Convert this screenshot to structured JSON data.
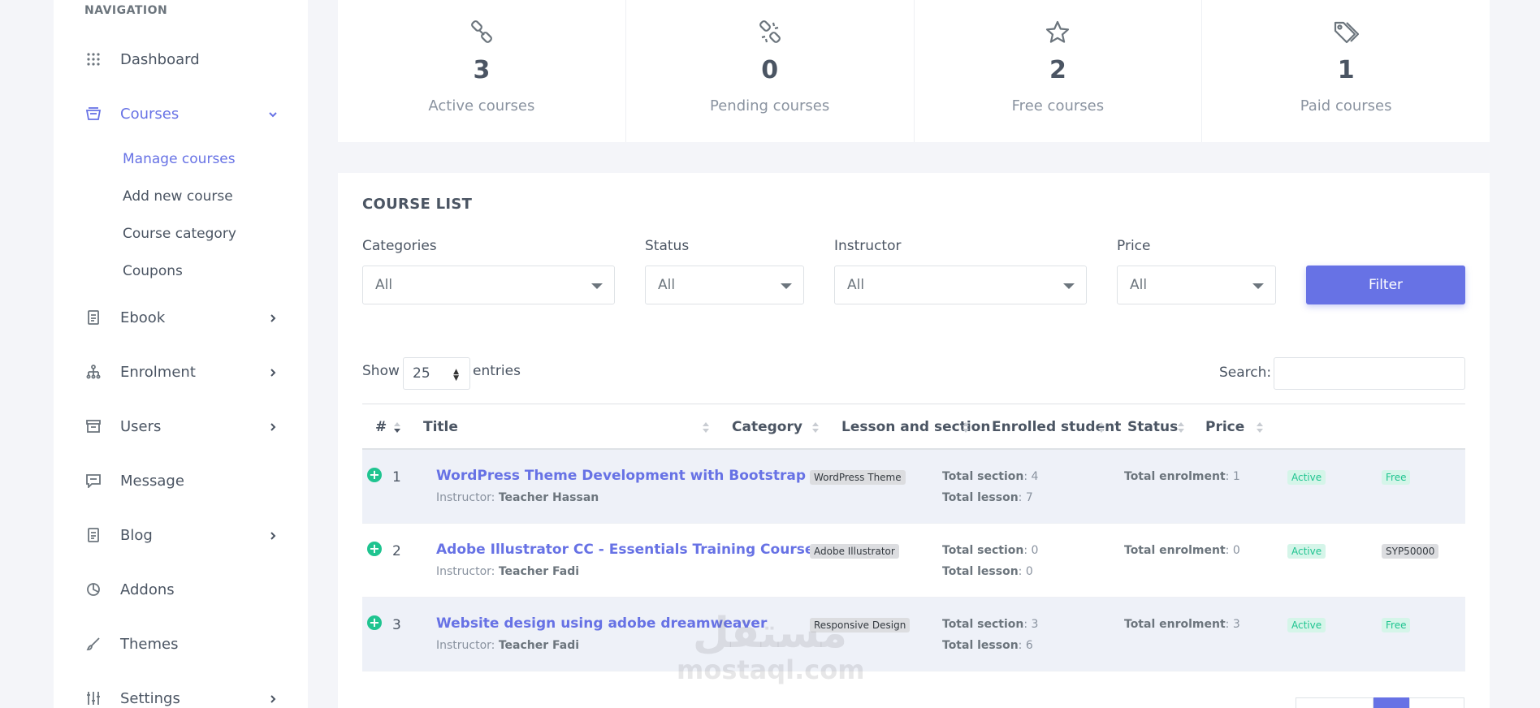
{
  "sidebar": {
    "title": "NAVIGATION",
    "items": [
      {
        "label": "Dashboard",
        "icon": "grid-icon"
      },
      {
        "label": "Courses",
        "icon": "courses-icon"
      },
      {
        "label": "Ebook",
        "icon": "book-icon"
      },
      {
        "label": "Enrolment",
        "icon": "sitemap-icon"
      },
      {
        "label": "Users",
        "icon": "archive-icon"
      },
      {
        "label": "Message",
        "icon": "message-icon"
      },
      {
        "label": "Blog",
        "icon": "document-icon"
      },
      {
        "label": "Addons",
        "icon": "addon-icon"
      },
      {
        "label": "Themes",
        "icon": "brush-icon"
      },
      {
        "label": "Settings",
        "icon": "sliders-icon"
      }
    ],
    "courses_sub": [
      "Manage courses",
      "Add new course",
      "Course category",
      "Coupons"
    ]
  },
  "stats": [
    {
      "value": "3",
      "label": "Active courses",
      "icon": "link-icon"
    },
    {
      "value": "0",
      "label": "Pending courses",
      "icon": "unlink-icon"
    },
    {
      "value": "2",
      "label": "Free courses",
      "icon": "star-icon"
    },
    {
      "value": "1",
      "label": "Paid courses",
      "icon": "tags-icon"
    }
  ],
  "course_list": {
    "title": "COURSE LIST",
    "filters": {
      "categories": {
        "label": "Categories",
        "value": "All"
      },
      "status": {
        "label": "Status",
        "value": "All"
      },
      "instructor": {
        "label": "Instructor",
        "value": "All"
      },
      "price": {
        "label": "Price",
        "value": "All"
      },
      "button": "Filter"
    },
    "show": "Show",
    "entries_value": "25",
    "entries": "entries",
    "search_label": "Search:"
  },
  "table": {
    "headers": [
      "#",
      "Title",
      "Category",
      "Lesson and section",
      "Enrolled student",
      "Status",
      "Price"
    ],
    "instructor_prefix": "Instructor: ",
    "section_prefix": "Total section",
    "lesson_prefix": "Total lesson",
    "enrolment_prefix": "Total enrolment",
    "rows": [
      {
        "num": "1",
        "title": "WordPress Theme Development with Bootstrap",
        "instructor": "Teacher Hassan",
        "category": "WordPress Theme",
        "sections": ": 4",
        "lessons": ": 7",
        "enrolment": ": 1",
        "status": "Active",
        "price": "Free"
      },
      {
        "num": "2",
        "title": "Adobe Illustrator CC - Essentials Training Course",
        "instructor": "Teacher Fadi",
        "category": "Adobe Illustrator",
        "sections": ": 0",
        "lessons": ": 0",
        "enrolment": ": 0",
        "status": "Active",
        "price": "SYP50000"
      },
      {
        "num": "3",
        "title": "Website design using adobe dreamweaver",
        "instructor": "Teacher Fadi",
        "category": "Responsive Design",
        "sections": ": 3",
        "lessons": ": 6",
        "enrolment": ": 3",
        "status": "Active",
        "price": "Free"
      }
    ]
  },
  "watermark": {
    "arabic": "مستقل",
    "latin": "mostaql.com"
  },
  "colors": {
    "accent": "#6772e5",
    "success": "#1fc490",
    "background": "#f4f5f9"
  }
}
